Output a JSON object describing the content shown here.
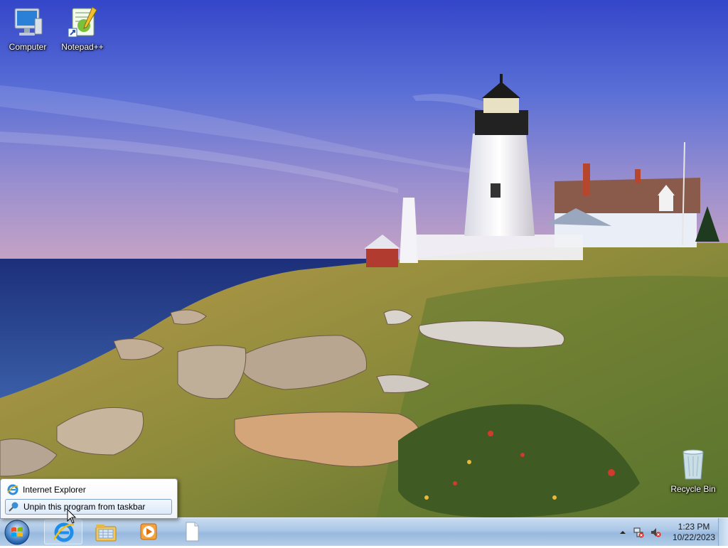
{
  "desktop": {
    "icons": [
      {
        "label": "Computer",
        "icon": "computer-icon"
      },
      {
        "label": "Notepad++",
        "icon": "notepadpp-icon"
      },
      {
        "label": "Recycle Bin",
        "icon": "recycle-bin-icon"
      }
    ]
  },
  "jumplist": {
    "items": [
      {
        "label": "Internet Explorer",
        "icon": "internet-explorer-icon"
      },
      {
        "label": "Unpin this program from taskbar",
        "icon": "unpin-icon"
      }
    ]
  },
  "taskbar": {
    "start": {
      "icon": "windows-start-orb-icon"
    },
    "buttons": [
      {
        "icon": "internet-explorer-icon"
      },
      {
        "icon": "windows-explorer-icon"
      },
      {
        "icon": "media-player-icon"
      },
      {
        "icon": "document-icon"
      }
    ],
    "tray": {
      "icons": [
        "show-hidden-icons-icon",
        "network-icon",
        "volume-muted-icon"
      ],
      "time": "1:23 PM",
      "date": "10/22/2023"
    }
  },
  "colors": {
    "taskbar": "#a9c6e6",
    "sky_top": "#3a4fd0",
    "sea": "#27408a"
  }
}
